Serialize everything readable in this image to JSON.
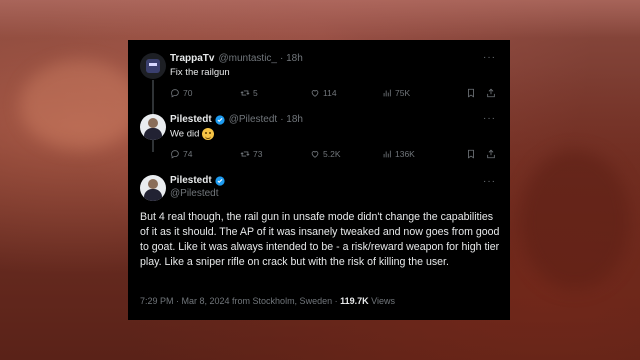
{
  "tweet1": {
    "name": "TrappaTv",
    "handle": "@muntastic_",
    "time": "· 18h",
    "text": "Fix the railgun",
    "replies": "70",
    "retweets": "5",
    "likes": "114",
    "views": "75K"
  },
  "tweet2": {
    "name": "Pilestedt",
    "handle": "@Pilestedt",
    "time": "· 18h",
    "text": "We did",
    "replies": "74",
    "retweets": "73",
    "likes": "5.2K",
    "views": "136K"
  },
  "tweet3": {
    "name": "Pilestedt",
    "handle": "@Pilestedt",
    "text": "But 4 real though, the rail gun in unsafe mode didn't change the capabilities of it as it should. The AP of it was insanely tweaked and now goes from good to goat. Like it was always intended to be - a risk/reward weapon for high tier play. Like a sniper rifle on crack but with the risk of killing the user.",
    "timestamp": "7:29 PM · Mar 8, 2024 from Stockholm, Sweden ·",
    "views_count": "119.7K",
    "views_label": "Views"
  },
  "more_label": "···",
  "colors": {
    "card_bg": "#000000",
    "text": "#e7e9ea",
    "muted": "#71767b",
    "verified": "#1d9bf0"
  }
}
